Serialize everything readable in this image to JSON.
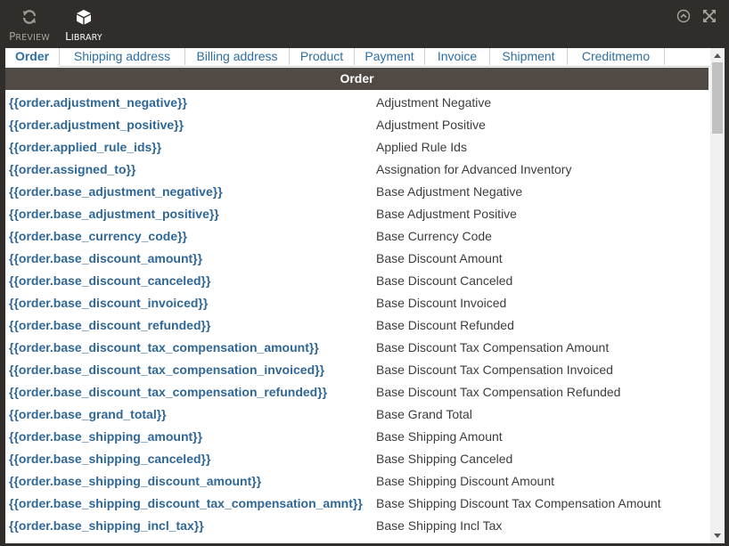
{
  "toolbar": {
    "preview_label": "Preview",
    "preview_icon": "refresh-icon",
    "library_label": "Library",
    "library_icon": "cube-icon",
    "collapse_icon": "collapse-up-icon",
    "fullscreen_icon": "fullscreen-icon"
  },
  "tabs": [
    {
      "label": "Order",
      "active": true
    },
    {
      "label": "Shipping address",
      "active": false
    },
    {
      "label": "Billing address",
      "active": false
    },
    {
      "label": "Product",
      "active": false
    },
    {
      "label": "Payment",
      "active": false
    },
    {
      "label": "Invoice",
      "active": false
    },
    {
      "label": "Shipment",
      "active": false
    },
    {
      "label": "Creditmemo",
      "active": false
    }
  ],
  "section": {
    "title": "Order"
  },
  "rows": [
    {
      "var": "{{order.adjustment_negative}}",
      "desc": "Adjustment Negative"
    },
    {
      "var": "{{order.adjustment_positive}}",
      "desc": "Adjustment Positive"
    },
    {
      "var": "{{order.applied_rule_ids}}",
      "desc": "Applied Rule Ids"
    },
    {
      "var": "{{order.assigned_to}}",
      "desc": "Assignation for Advanced Inventory"
    },
    {
      "var": "{{order.base_adjustment_negative}}",
      "desc": "Base Adjustment Negative"
    },
    {
      "var": "{{order.base_adjustment_positive}}",
      "desc": "Base Adjustment Positive"
    },
    {
      "var": "{{order.base_currency_code}}",
      "desc": "Base Currency Code"
    },
    {
      "var": "{{order.base_discount_amount}}",
      "desc": "Base Discount Amount"
    },
    {
      "var": "{{order.base_discount_canceled}}",
      "desc": "Base Discount Canceled"
    },
    {
      "var": "{{order.base_discount_invoiced}}",
      "desc": "Base Discount Invoiced"
    },
    {
      "var": "{{order.base_discount_refunded}}",
      "desc": "Base Discount Refunded"
    },
    {
      "var": "{{order.base_discount_tax_compensation_amount}}",
      "desc": "Base Discount Tax Compensation Amount"
    },
    {
      "var": "{{order.base_discount_tax_compensation_invoiced}}",
      "desc": "Base Discount Tax Compensation Invoiced"
    },
    {
      "var": "{{order.base_discount_tax_compensation_refunded}}",
      "desc": "Base Discount Tax Compensation Refunded"
    },
    {
      "var": "{{order.base_grand_total}}",
      "desc": "Base Grand Total"
    },
    {
      "var": "{{order.base_shipping_amount}}",
      "desc": "Base Shipping Amount"
    },
    {
      "var": "{{order.base_shipping_canceled}}",
      "desc": "Base Shipping Canceled"
    },
    {
      "var": "{{order.base_shipping_discount_amount}}",
      "desc": "Base Shipping Discount Amount"
    },
    {
      "var": "{{order.base_shipping_discount_tax_compensation_amnt}}",
      "desc": "Base Shipping Discount Tax Compensation Amount"
    },
    {
      "var": "{{order.base_shipping_incl_tax}}",
      "desc": "Base Shipping Incl Tax"
    }
  ],
  "colors": {
    "toolbar_bg": "#302d2a",
    "section_header_bg": "#514943",
    "link": "#2f6797",
    "text": "#3d3d3d"
  }
}
